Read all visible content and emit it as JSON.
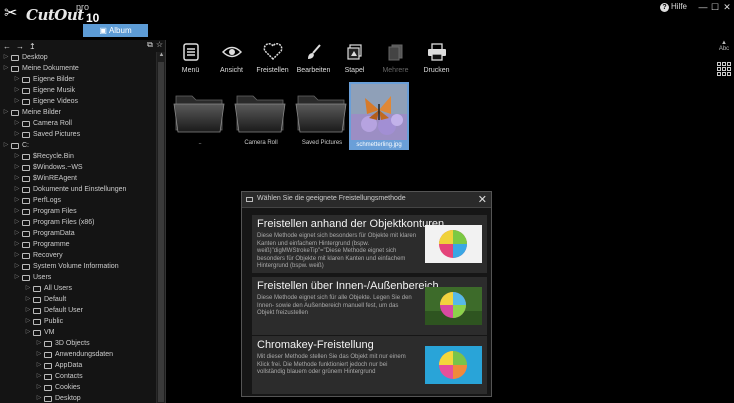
{
  "app": {
    "name": "CutOut",
    "edition": "pro",
    "version": "10",
    "album_tab": "Album",
    "help": "Hilfe"
  },
  "toolbar": {
    "items": [
      {
        "label": "Menü",
        "icon": "menu-icon"
      },
      {
        "label": "Ansicht",
        "icon": "eye-icon"
      },
      {
        "label": "Freistellen",
        "icon": "heart-cutout-icon"
      },
      {
        "label": "Bearbeiten",
        "icon": "brush-icon"
      },
      {
        "label": "Stapel",
        "icon": "batch-icon"
      },
      {
        "label": "Mehrere",
        "icon": "multiple-icon",
        "disabled": true
      },
      {
        "label": "Drucken",
        "icon": "printer-icon"
      }
    ],
    "sort_label": "Abc"
  },
  "tree": {
    "items": [
      {
        "label": "Desktop",
        "level": 0
      },
      {
        "label": "Meine Dokumente",
        "level": 0
      },
      {
        "label": "Eigene Bilder",
        "level": 1
      },
      {
        "label": "Eigene Musik",
        "level": 1
      },
      {
        "label": "Eigene Videos",
        "level": 1
      },
      {
        "label": "Meine Bilder",
        "level": 0
      },
      {
        "label": "Camera Roll",
        "level": 1
      },
      {
        "label": "Saved Pictures",
        "level": 1
      },
      {
        "label": "C:",
        "level": 0,
        "drive": true
      },
      {
        "label": "$Recycle.Bin",
        "level": 1
      },
      {
        "label": "$Windows.~WS",
        "level": 1
      },
      {
        "label": "$WinREAgent",
        "level": 1
      },
      {
        "label": "Dokumente und Einstellungen",
        "level": 1
      },
      {
        "label": "PerfLogs",
        "level": 1
      },
      {
        "label": "Program Files",
        "level": 1
      },
      {
        "label": "Program Files (x86)",
        "level": 1
      },
      {
        "label": "ProgramData",
        "level": 1
      },
      {
        "label": "Programme",
        "level": 1
      },
      {
        "label": "Recovery",
        "level": 1
      },
      {
        "label": "System Volume Information",
        "level": 1
      },
      {
        "label": "Users",
        "level": 1
      },
      {
        "label": "All Users",
        "level": 2
      },
      {
        "label": "Default",
        "level": 2
      },
      {
        "label": "Default User",
        "level": 2
      },
      {
        "label": "Public",
        "level": 2
      },
      {
        "label": "VM",
        "level": 2
      },
      {
        "label": "3D Objects",
        "level": 3
      },
      {
        "label": "Anwendungsdaten",
        "level": 3
      },
      {
        "label": "AppData",
        "level": 3
      },
      {
        "label": "Contacts",
        "level": 3
      },
      {
        "label": "Cookies",
        "level": 3
      },
      {
        "label": "Desktop",
        "level": 3
      }
    ]
  },
  "files": [
    {
      "name": "..",
      "type": "folder"
    },
    {
      "name": "Camera Roll",
      "type": "folder"
    },
    {
      "name": "Saved Pictures",
      "type": "folder"
    },
    {
      "name": "schmetterling.jpg",
      "type": "image",
      "selected": true
    }
  ],
  "dialog": {
    "title": "Wählen Sie die geeignete Freistellungsmethode",
    "options": [
      {
        "title": "Freistellen anhand der Objektkonturen",
        "description": "Diese Methode eignet sich besonders für Objekte mit klaren Kanten und einfachem Hintergrund (bspw. weiß)\"digMWStrokeTip\"=\"Diese Methode eignet sich besonders für Objekte mit klaren Kanten und einfachem Hintergrund (bspw. weiß)",
        "image": "colorful-ball-white-background"
      },
      {
        "title": "Freistellen über Innen-/Außenbereich",
        "description": "Diese Methode eignet sich für alle Objekte. Legen Sie den Innen- sowie den Außenbereich manuell fest, um das Objekt freizustellen",
        "image": "colorful-ball-on-grass"
      },
      {
        "title": "Chromakey-Freistellung",
        "description": "Mit dieser Methode stellen Sie das Objekt mit nur einem Klick frei. Die Methode funktioniert jedoch nur bei vollständig blauem oder grünem Hintergrund",
        "image": "colorful-ball-blue-background"
      }
    ]
  },
  "colors": {
    "accent": "#5d9cd6",
    "background": "#000000",
    "panel": "#141414"
  }
}
